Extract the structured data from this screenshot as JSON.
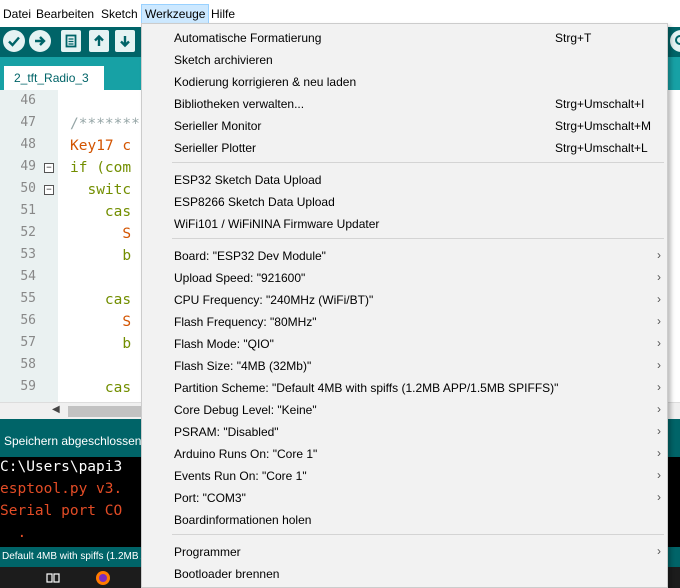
{
  "menubar": {
    "items": [
      "Datei",
      "Bearbeiten",
      "Sketch",
      "Werkzeuge",
      "Hilfe"
    ]
  },
  "toolbar": {
    "verify_icon": "check-icon",
    "upload_icon": "arrow-right-icon",
    "new_icon": "new-file-icon",
    "open_icon": "arrow-up-icon",
    "save_icon": "arrow-down-icon",
    "serial_icon": "magnifier-icon"
  },
  "tabs": [
    "2_tft_Radio_3"
  ],
  "editor": {
    "lines": [
      {
        "num": "46",
        "fold": "",
        "text": ""
      },
      {
        "num": "47",
        "fold": "",
        "text": "/*******"
      },
      {
        "num": "48",
        "fold": "",
        "text": "Key17 c"
      },
      {
        "num": "49",
        "fold": "⊟",
        "text": "if (com"
      },
      {
        "num": "50",
        "fold": "⊟",
        "text": "  switc"
      },
      {
        "num": "51",
        "fold": "",
        "text": "    cas"
      },
      {
        "num": "52",
        "fold": "",
        "text": "      S"
      },
      {
        "num": "53",
        "fold": "",
        "text": "      b"
      },
      {
        "num": "54",
        "fold": "",
        "text": ""
      },
      {
        "num": "55",
        "fold": "",
        "text": "    cas"
      },
      {
        "num": "56",
        "fold": "",
        "text": "      S"
      },
      {
        "num": "57",
        "fold": "",
        "text": "      b"
      },
      {
        "num": "58",
        "fold": "",
        "text": ""
      },
      {
        "num": "59",
        "fold": "",
        "text": "    cas"
      }
    ]
  },
  "console": {
    "status": "Speichern abgeschlossen.",
    "lines": [
      {
        "text": "C:\\Users\\papi3",
        "color": "#ffffff"
      },
      {
        "text": "esptool.py v3.",
        "color": "#e34c26"
      },
      {
        "text": "Serial port CO",
        "color": "#e34c26"
      },
      {
        "text": "  .",
        "color": "#e34c26"
      }
    ],
    "bottom_status": "Default 4MB with spiffs (1.2MB A"
  },
  "colors": {
    "teal_dark": "#006468",
    "teal_light": "#17a1a5",
    "menu_highlight": "#cce8ff"
  },
  "menu": {
    "items": [
      {
        "label": "Automatische Formatierung",
        "shortcut": "Strg+T"
      },
      {
        "label": "Sketch archivieren",
        "shortcut": ""
      },
      {
        "label": "Kodierung korrigieren & neu laden",
        "shortcut": ""
      },
      {
        "label": "Bibliotheken verwalten...",
        "shortcut": "Strg+Umschalt+I"
      },
      {
        "label": "Serieller Monitor",
        "shortcut": "Strg+Umschalt+M"
      },
      {
        "label": "Serieller Plotter",
        "shortcut": "Strg+Umschalt+L"
      },
      {
        "label": "ESP32 Sketch Data Upload",
        "shortcut": ""
      },
      {
        "label": "ESP8266 Sketch Data Upload",
        "shortcut": ""
      },
      {
        "label": "WiFi101 / WiFiNINA Firmware Updater",
        "shortcut": ""
      },
      {
        "label": "Board: \"ESP32 Dev Module\"",
        "shortcut": "",
        "submenu": true
      },
      {
        "label": "Upload Speed: \"921600\"",
        "shortcut": "",
        "submenu": true
      },
      {
        "label": "CPU Frequency: \"240MHz (WiFi/BT)\"",
        "shortcut": "",
        "submenu": true
      },
      {
        "label": "Flash Frequency: \"80MHz\"",
        "shortcut": "",
        "submenu": true
      },
      {
        "label": "Flash Mode: \"QIO\"",
        "shortcut": "",
        "submenu": true
      },
      {
        "label": "Flash Size: \"4MB (32Mb)\"",
        "shortcut": "",
        "submenu": true
      },
      {
        "label": "Partition Scheme: \"Default 4MB with spiffs (1.2MB APP/1.5MB SPIFFS)\"",
        "shortcut": "",
        "submenu": true
      },
      {
        "label": "Core Debug Level: \"Keine\"",
        "shortcut": "",
        "submenu": true
      },
      {
        "label": "PSRAM: \"Disabled\"",
        "shortcut": "",
        "submenu": true
      },
      {
        "label": "Arduino Runs On: \"Core 1\"",
        "shortcut": "",
        "submenu": true
      },
      {
        "label": "Events Run On: \"Core 1\"",
        "shortcut": "",
        "submenu": true
      },
      {
        "label": "Port: \"COM3\"",
        "shortcut": "",
        "submenu": true
      },
      {
        "label": "Boardinformationen holen",
        "shortcut": ""
      },
      {
        "label": "Programmer",
        "shortcut": "",
        "submenu": true
      },
      {
        "label": "Bootloader brennen",
        "shortcut": ""
      }
    ]
  }
}
